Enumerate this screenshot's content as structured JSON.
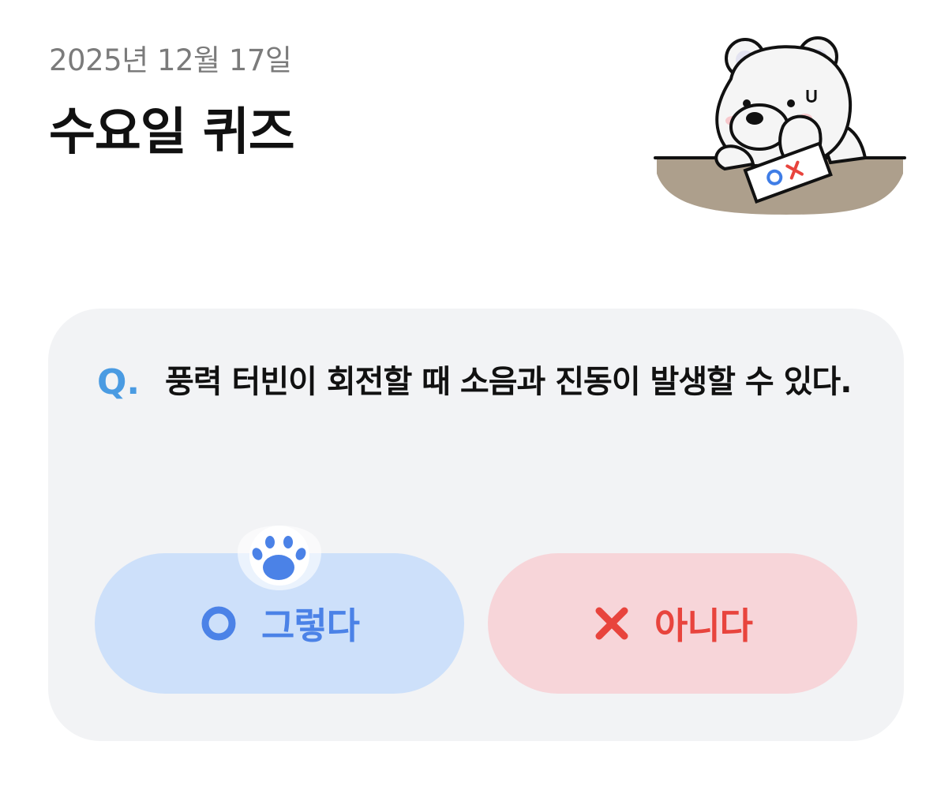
{
  "header": {
    "date": "2025년 12월 17일",
    "title": "수요일 퀴즈"
  },
  "illustration": {
    "icon": "polar-bear-thinking-ox-paper",
    "paper_text": "OX"
  },
  "quiz": {
    "q_prefix": "Q.",
    "question": "풍력 터빈이 회전할 때 소음과 진동이 발생할 수 있다."
  },
  "answers": {
    "yes": {
      "label": "그렇다",
      "icon": "circle-o-icon",
      "color": "#4b82e7",
      "bg": "#cde0fa"
    },
    "no": {
      "label": "아니다",
      "icon": "x-mark-icon",
      "color": "#e8443d",
      "bg": "#f7d5d9"
    }
  },
  "colors": {
    "card_bg": "#f2f3f5",
    "q_prefix": "#4a9be2",
    "paw": "#4b82e7"
  }
}
